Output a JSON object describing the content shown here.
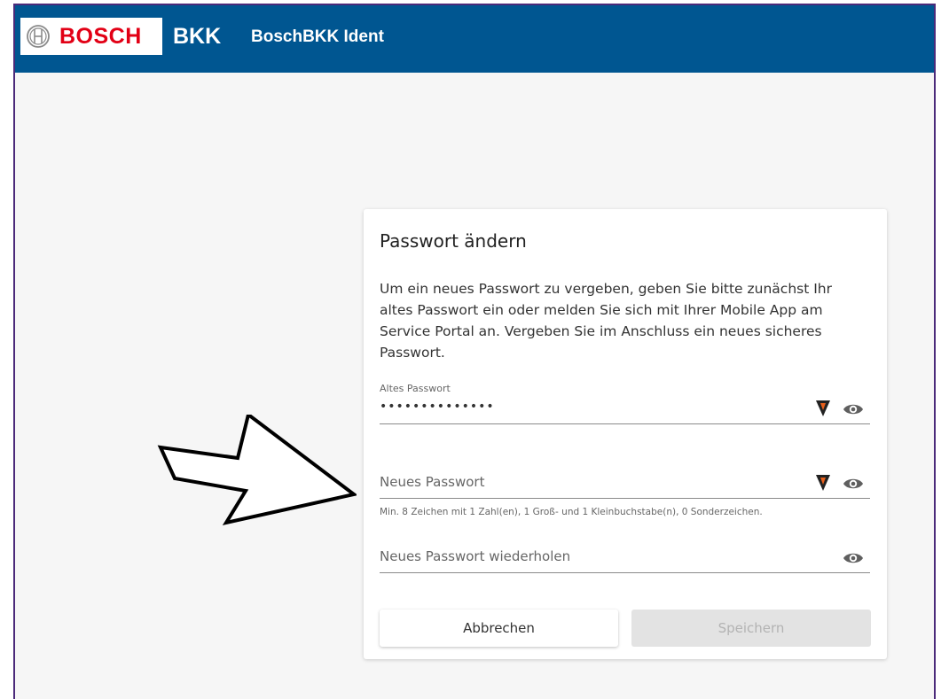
{
  "header": {
    "brand_logo": "BOSCH",
    "brand_short": "BKK",
    "app_title": "BoschBKK Ident",
    "bar_color": "#005691",
    "logo_red": "#e20015"
  },
  "card": {
    "title": "Passwort ändern",
    "description": "Um ein neues Passwort zu vergeben, geben Sie bitte zunächst Ihr altes Passwort ein oder melden Sie sich mit Ihrer Mobile App am Service Portal an. Vergeben Sie im Anschluss ein neues sicheres Passwort.",
    "old_password": {
      "label": "Altes Passwort",
      "value": "••••••••••••••"
    },
    "new_password": {
      "placeholder": "Neues Passwort",
      "hint": "Min. 8 Zeichen mit 1 Zahl(en), 1 Groß- und 1 Kleinbuchstabe(n), 0 Sonderzeichen."
    },
    "repeat_password": {
      "placeholder": "Neues Passwort wiederholen"
    },
    "buttons": {
      "cancel": "Abbrechen",
      "save": "Speichern"
    }
  },
  "icons": {
    "password_manager": "password-manager-icon",
    "visibility": "eye-icon",
    "annotation": "arrow-annotation"
  }
}
